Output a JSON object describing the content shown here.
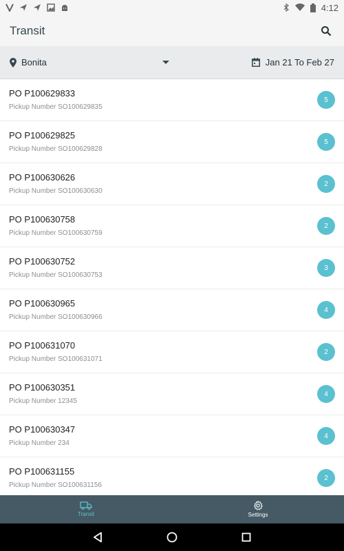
{
  "status_bar": {
    "time": "4:12"
  },
  "app_bar": {
    "title": "Transit"
  },
  "filters": {
    "location": "Bonita",
    "date_range": "Jan 21 To Feb 27"
  },
  "items": [
    {
      "po": "PO P100629833",
      "pickup": "Pickup Number SO100629835",
      "count": "5"
    },
    {
      "po": "PO P100629825",
      "pickup": "Pickup Number SO100629828",
      "count": "5"
    },
    {
      "po": "PO P100630626",
      "pickup": "Pickup Number SO100630630",
      "count": "2"
    },
    {
      "po": "PO P100630758",
      "pickup": "Pickup Number SO100630759",
      "count": "2"
    },
    {
      "po": "PO P100630752",
      "pickup": "Pickup Number SO100630753",
      "count": "3"
    },
    {
      "po": "PO P100630965",
      "pickup": "Pickup Number SO100630966",
      "count": "4"
    },
    {
      "po": "PO P100631070",
      "pickup": "Pickup Number SO100631071",
      "count": "2"
    },
    {
      "po": "PO P100630351",
      "pickup": "Pickup Number 12345",
      "count": "4"
    },
    {
      "po": "PO P100630347",
      "pickup": "Pickup Number 234",
      "count": "4"
    },
    {
      "po": "PO P100631155",
      "pickup": "Pickup Number SO100631156",
      "count": "2"
    }
  ],
  "bottom_nav": {
    "transit_label": "Transit",
    "settings_label": "Settings"
  },
  "colors": {
    "accent": "#5bc0d0",
    "nav_background": "#455a64",
    "filter_background": "#e9ebed"
  },
  "icons": {
    "status_left": [
      "v-icon",
      "send-icon",
      "send-icon",
      "image-icon",
      "android-icon"
    ],
    "status_right": [
      "bluetooth-icon",
      "wifi-icon",
      "battery-icon"
    ],
    "search": "search-icon",
    "location": "location-pin-icon",
    "dropdown": "dropdown-arrow-icon",
    "calendar": "calendar-icon",
    "transit": "truck-icon",
    "settings": "gear-icon"
  }
}
